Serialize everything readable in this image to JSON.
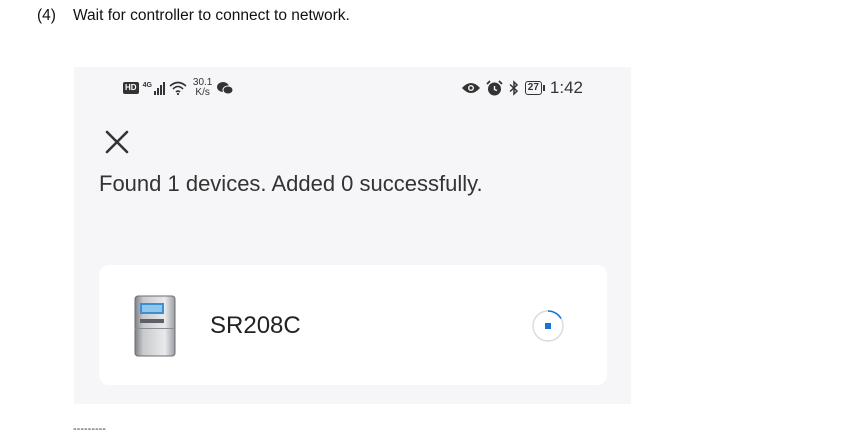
{
  "instruction": {
    "step_number": "(4)",
    "text": "Wait for controller to connect to network."
  },
  "statusbar": {
    "hd_badge": "HD",
    "network_type": "4G",
    "speed_value": "30.1",
    "speed_unit": "K/s",
    "battery_level": "27",
    "time": "1:42"
  },
  "dialog": {
    "close_icon": "close-icon",
    "message": "Found 1 devices. Added 0 successfully."
  },
  "device": {
    "name": "SR208C",
    "status_icon": "loading-spinner-icon"
  },
  "footer": {
    "separator": "---------"
  },
  "colors": {
    "spinner_accent": "#1a73d8",
    "phone_background": "#f6f6f8",
    "card_background": "#ffffff"
  }
}
